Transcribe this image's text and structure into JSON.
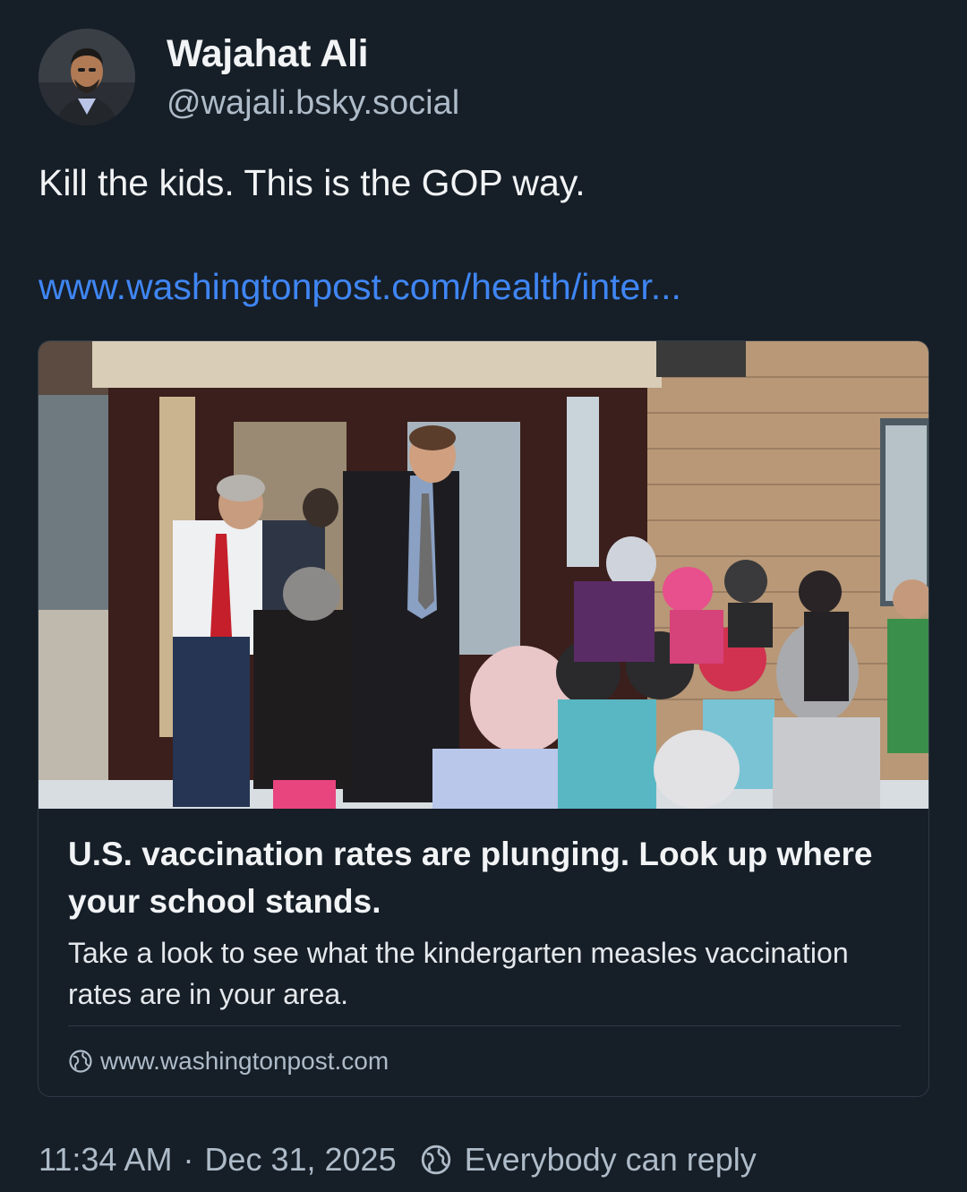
{
  "author": {
    "display_name": "Wajahat Ali",
    "handle": "@wajali.bsky.social",
    "avatar_icon": "profile-photo"
  },
  "post": {
    "text": "Kill the kids. This is the GOP way.",
    "link_text": "www.washingtonpost.com/health/inter..."
  },
  "embed": {
    "title": "U.S. vaccination rates are plunging. Look up where your school stands.",
    "description": "Take a look to see what the kindergarten measles vaccination rates are in your area.",
    "domain": "www.washingtonpost.com",
    "domain_icon": "globe-icon"
  },
  "footer": {
    "time": "11:34 AM",
    "separator": "·",
    "date": "Dec 31, 2025",
    "reply_setting": "Everybody can reply",
    "reply_icon": "globe-icon"
  },
  "colors": {
    "background": "#161e27",
    "link": "#3f86f4",
    "muted_text": "#aebbc9",
    "border": "#2e3a48"
  }
}
